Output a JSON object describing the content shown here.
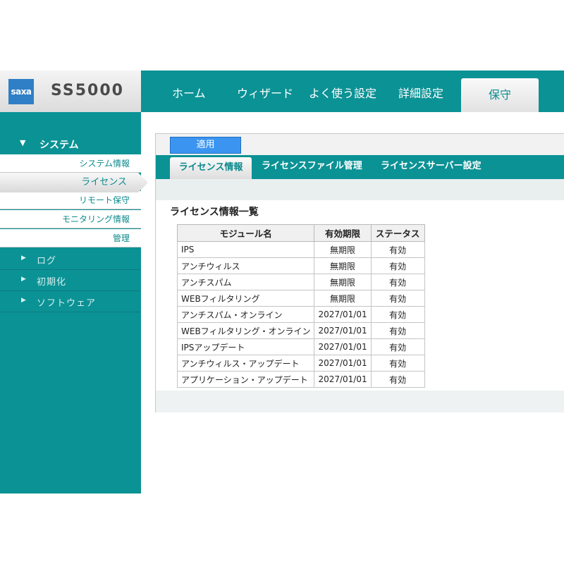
{
  "header": {
    "logo_text": "saxa",
    "product_name": "SS5000",
    "nav": [
      {
        "label": "ホーム"
      },
      {
        "label": "ウィザード"
      },
      {
        "label": "よく使う設定"
      },
      {
        "label": "詳細設定"
      },
      {
        "label": "保守"
      }
    ],
    "active_nav": "保守"
  },
  "sidebar": {
    "expanded_group": {
      "arrow": "▼",
      "label": "システム"
    },
    "sub_items": [
      {
        "label": "システム情報"
      },
      {
        "label": "ライセンス"
      },
      {
        "label": "リモート保守"
      },
      {
        "label": "モニタリング情報"
      },
      {
        "label": "管理"
      }
    ],
    "active_sub_item": "ライセンス",
    "groups": [
      {
        "arrow": "▶",
        "label": "ログ"
      },
      {
        "arrow": "▶",
        "label": "初期化"
      },
      {
        "arrow": "▶",
        "label": "ソフトウェア"
      }
    ]
  },
  "toolbar": {
    "apply_label": "適用"
  },
  "tabs": [
    {
      "label": "ライセンス情報"
    },
    {
      "label": "ライセンスファイル管理"
    },
    {
      "label": "ライセンスサーバー設定"
    }
  ],
  "active_tab": "ライセンス情報",
  "section_title": "ライセンス情報一覧",
  "table": {
    "headers": [
      "モジュール名",
      "有効期限",
      "ステータス"
    ],
    "rows": [
      {
        "module": "IPS",
        "expiry": "無期限",
        "status": "有効"
      },
      {
        "module": "アンチウィルス",
        "expiry": "無期限",
        "status": "有効"
      },
      {
        "module": "アンチスパム",
        "expiry": "無期限",
        "status": "有効"
      },
      {
        "module": "WEBフィルタリング",
        "expiry": "無期限",
        "status": "有効"
      },
      {
        "module": "アンチスパム・オンライン",
        "expiry": "2027/01/01",
        "status": "有効"
      },
      {
        "module": "WEBフィルタリング・オンライン",
        "expiry": "2027/01/01",
        "status": "有効"
      },
      {
        "module": "IPSアップデート",
        "expiry": "2027/01/01",
        "status": "有効"
      },
      {
        "module": "アンチウィルス・アップデート",
        "expiry": "2027/01/01",
        "status": "有効"
      },
      {
        "module": "アプリケーション・アップデート",
        "expiry": "2027/01/01",
        "status": "有効"
      }
    ]
  },
  "colors": {
    "accent": "#0b9295",
    "button": "#3b95f0"
  }
}
